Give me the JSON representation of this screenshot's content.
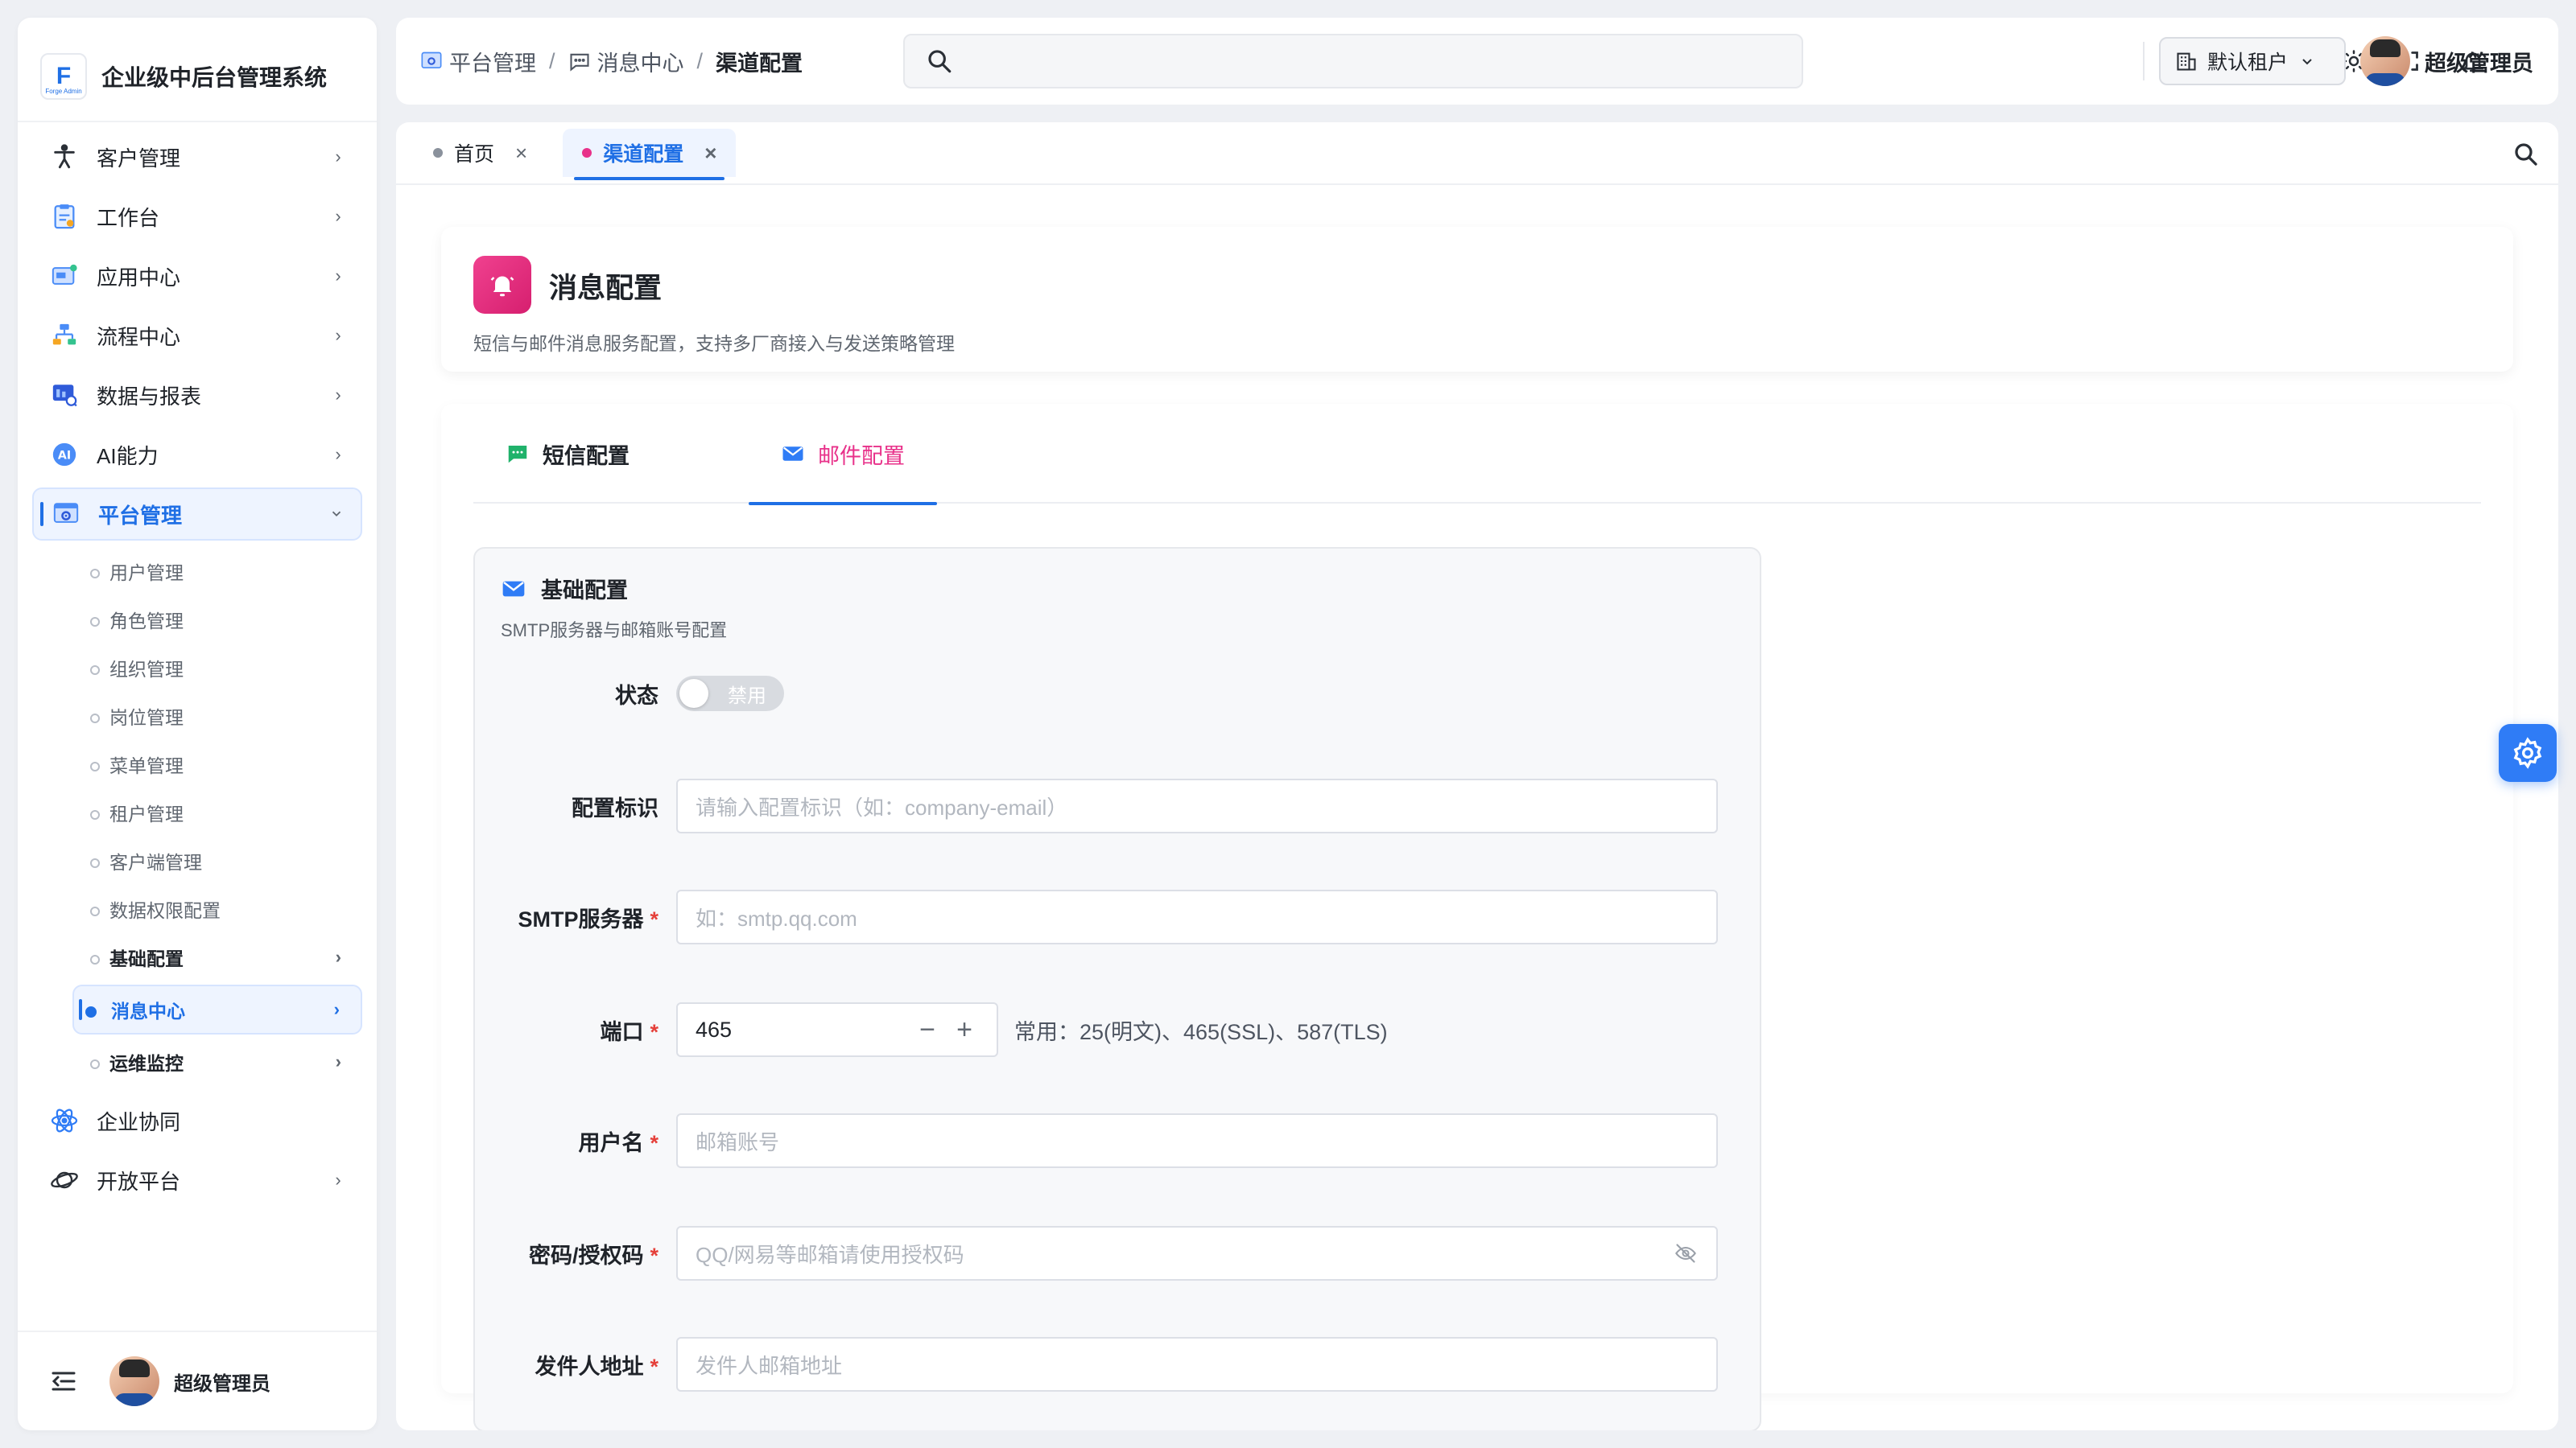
{
  "sidebar": {
    "brand": {
      "title": "企业级中后台管理系统",
      "logo_text": "F",
      "logo_small": "Forge Admin"
    },
    "menu": [
      {
        "label": "客户管理",
        "icon": "accessibility-icon"
      },
      {
        "label": "工作台",
        "icon": "clipboard-icon"
      },
      {
        "label": "应用中心",
        "icon": "apps-icon"
      },
      {
        "label": "流程中心",
        "icon": "workflow-icon"
      },
      {
        "label": "数据与报表",
        "icon": "report-icon"
      },
      {
        "label": "AI能力",
        "icon": "ai-icon"
      },
      {
        "label": "平台管理",
        "icon": "platform-icon",
        "expanded": true
      }
    ],
    "platform_sub": [
      {
        "label": "用户管理"
      },
      {
        "label": "角色管理"
      },
      {
        "label": "组织管理"
      },
      {
        "label": "岗位管理"
      },
      {
        "label": "菜单管理"
      },
      {
        "label": "租户管理"
      },
      {
        "label": "客户端管理"
      },
      {
        "label": "数据权限配置"
      },
      {
        "label": "基础配置"
      },
      {
        "label": "消息中心"
      },
      {
        "label": "运维监控"
      }
    ],
    "bottom_menu": [
      {
        "label": "企业协同",
        "icon": "atom-icon"
      },
      {
        "label": "开放平台",
        "icon": "planet-icon"
      }
    ],
    "footer": {
      "username": "超级管理员"
    }
  },
  "header": {
    "breadcrumb": [
      "平台管理",
      "消息中心",
      "渠道配置"
    ],
    "search": {
      "placeholder": ""
    },
    "tenant": "默认租户",
    "username": "超级管理员"
  },
  "tabs": [
    {
      "label": "首页"
    },
    {
      "label": "渠道配置",
      "active": true
    }
  ],
  "page": {
    "title": "消息配置",
    "description": "短信与邮件消息服务配置，支持多厂商接入与发送策略管理"
  },
  "config_tabs": [
    {
      "label": "短信配置"
    },
    {
      "label": "邮件配置",
      "active": true
    }
  ],
  "basic": {
    "title": "基础配置",
    "subtitle": "SMTP服务器与邮箱账号配置",
    "status": {
      "label": "状态",
      "switch_text": "禁用",
      "enabled": false
    },
    "config_id": {
      "label": "配置标识",
      "placeholder": "请输入配置标识（如：company-email）"
    },
    "smtp": {
      "label": "SMTP服务器",
      "placeholder": "如：smtp.qq.com",
      "required": "*"
    },
    "port": {
      "label": "端口",
      "value": "465",
      "hint": "常用：25(明文)、465(SSL)、587(TLS)",
      "required": "*"
    },
    "username": {
      "label": "用户名",
      "placeholder": "邮箱账号",
      "required": "*"
    },
    "password": {
      "label": "密码/授权码",
      "placeholder": "QQ/网易等邮箱请使用授权码",
      "required": "*"
    },
    "sender": {
      "label": "发件人地址",
      "placeholder": "发件人邮箱地址",
      "required": "*"
    }
  },
  "colors": {
    "primary": "#1f6fe5",
    "accent_pink": "#e8318a",
    "required": "#e5403a"
  }
}
